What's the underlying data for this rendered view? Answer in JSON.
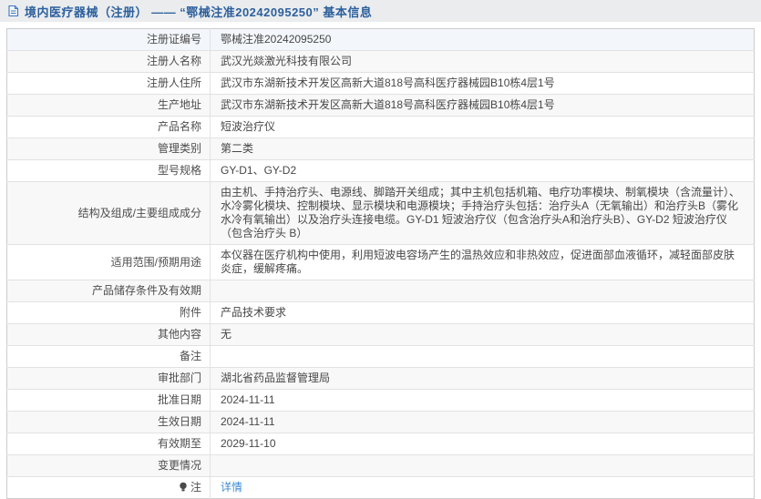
{
  "page": {
    "title": "境内医疗器械（注册） ——  “鄂械注准20242095250”  基本信息"
  },
  "colors": {
    "header_bg": "#eaecee",
    "title_blue": "#2c5f9c",
    "link_blue": "#3d8bd4",
    "stripe_gray": "#f8f8f8",
    "hover_row": "#f3f6fa",
    "border_gray": "#cccccc"
  },
  "table": {
    "rows": [
      {
        "label": "注册证编号",
        "value": "鄂械注准20242095250",
        "highlight": true
      },
      {
        "label": "注册人名称",
        "value": "武汉光燚激光科技有限公司"
      },
      {
        "label": "注册人住所",
        "value": "武汉市东湖新技术开发区高新大道818号高科医疗器械园B10栋4层1号"
      },
      {
        "label": "生产地址",
        "value": "武汉市东湖新技术开发区高新大道818号高科医疗器械园B10栋4层1号"
      },
      {
        "label": "产品名称",
        "value": "短波治疗仪"
      },
      {
        "label": "管理类别",
        "value": "第二类"
      },
      {
        "label": "型号规格",
        "value": "GY-D1、GY-D2"
      },
      {
        "label": "结构及组成/主要组成成分",
        "value": "由主机、手持治疗头、电源线、脚踏开关组成；其中主机包括机箱、电疗功率模块、制氧模块（含流量计）、水冷雾化模块、控制模块、显示模块和电源模块；手持治疗头包括：治疗头A（无氧输出）和治疗头B（雾化水冷有氧输出）以及治疗头连接电缆。GY-D1 短波治疗仪（包含治疗头A和治疗头B）、GY-D2 短波治疗仪（包含治疗头 B）"
      },
      {
        "label": "适用范围/预期用途",
        "value": "本仪器在医疗机构中使用，利用短波电容场产生的温热效应和非热效应，促进面部血液循环，减轻面部皮肤炎症，缓解疼痛。"
      },
      {
        "label": "产品储存条件及有效期",
        "value": ""
      },
      {
        "label": "附件",
        "value": "产品技术要求"
      },
      {
        "label": "其他内容",
        "value": "无"
      },
      {
        "label": "备注",
        "value": ""
      },
      {
        "label": "审批部门",
        "value": "湖北省药品监督管理局"
      },
      {
        "label": "批准日期",
        "value": "2024-11-11"
      },
      {
        "label": "生效日期",
        "value": "2024-11-11"
      },
      {
        "label": "有效期至",
        "value": "2029-11-10"
      },
      {
        "label": "变更情况",
        "value": ""
      },
      {
        "label": "注",
        "label_icon": "bulb-icon",
        "value": "详情",
        "value_is_link": true
      }
    ]
  }
}
